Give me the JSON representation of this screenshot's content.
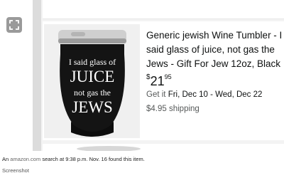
{
  "toolbar": {
    "expand_icon": "expand-icon"
  },
  "product": {
    "title": "Generic jewish Wine Tumbler - I said glass of juice, not gas the Jews - Gift For Jew 12oz, Black",
    "image_text": [
      "I said glass of",
      "JUICE",
      "not gas the",
      "JEWS"
    ],
    "price_symbol": "$",
    "price_whole": "21",
    "price_fraction": "95",
    "delivery_prefix": "Get it",
    "delivery_dates": "Fri, Dec 10 - Wed, Dec 22",
    "shipping": "$4.95 shipping"
  },
  "caption": {
    "prefix": "An",
    "site": "amazon.com",
    "rest": "search at 9:38 p.m. Nov. 16 found this item.",
    "credit": "Screenshot"
  },
  "colors": {
    "tumbler": "#111111",
    "text": "#0f1111",
    "muted": "#565959"
  }
}
